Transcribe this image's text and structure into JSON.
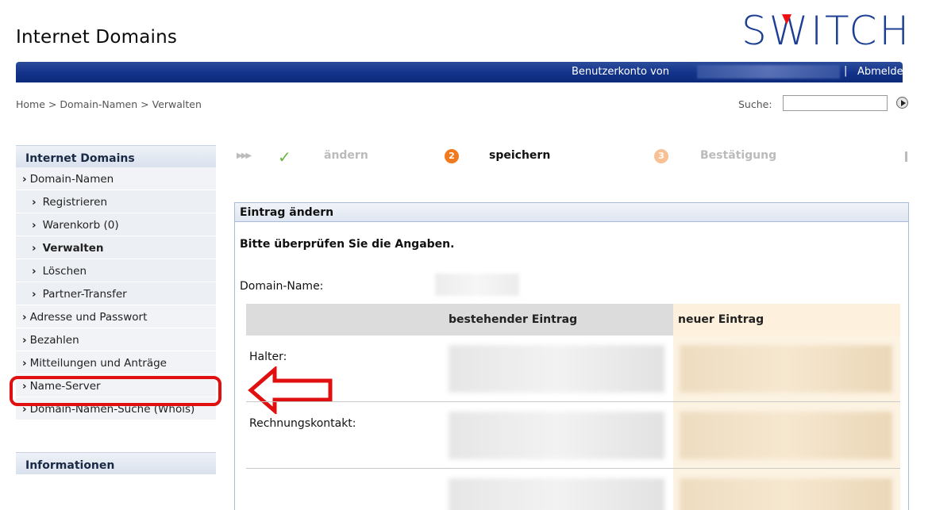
{
  "header": {
    "site_title": "Internet Domains",
    "logo_text": "SWITCH",
    "account_label": "Benutzerkonto von",
    "separator": "|",
    "logout_label": "Abmelden"
  },
  "breadcrumb": [
    "Home",
    "Domain-Namen",
    "Verwalten"
  ],
  "search": {
    "label": "Suche:",
    "value": ""
  },
  "sidebar": {
    "section1": "Internet Domains",
    "items": [
      {
        "label": "Domain-Namen",
        "level": 1
      },
      {
        "label": "Registrieren",
        "level": 2
      },
      {
        "label": "Warenkorb (0)",
        "level": 2
      },
      {
        "label": "Verwalten",
        "level": 2,
        "active": true
      },
      {
        "label": "Löschen",
        "level": 2
      },
      {
        "label": "Partner-Transfer",
        "level": 2
      },
      {
        "label": "Adresse und Passwort",
        "level": 1
      },
      {
        "label": "Bezahlen",
        "level": 1
      },
      {
        "label": "Mitteilungen und Anträge",
        "level": 1
      },
      {
        "label": "Name-Server",
        "level": 1,
        "highlighted": true
      },
      {
        "label": "Domain-Namen-Suche (Whois)",
        "level": 1
      }
    ],
    "section2": "Informationen"
  },
  "steps": [
    {
      "label": "ändern",
      "state": "done"
    },
    {
      "num": "2",
      "label": "speichern",
      "state": "current"
    },
    {
      "num": "3",
      "label": "Bestätigung",
      "state": "upcoming"
    }
  ],
  "panel": {
    "title": "Eintrag ändern",
    "message": "Bitte überprüfen Sie die Angaben.",
    "domain_label": "Domain-Name:",
    "col_existing": "bestehender Eintrag",
    "col_new": "neuer Eintrag",
    "rows": [
      "Halter:",
      "Rechnungskontakt:"
    ]
  },
  "colors": {
    "topbar": "#12338a",
    "logo": "#1c3f93",
    "highlight": "#e01010",
    "step_orange": "#f07a1d"
  }
}
